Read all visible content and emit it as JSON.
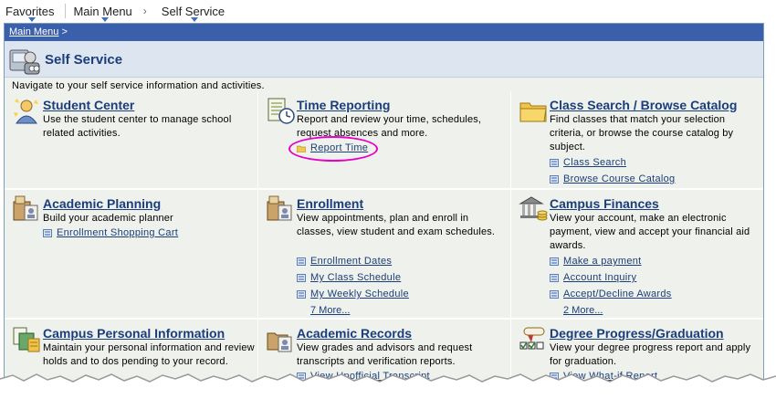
{
  "topnav": {
    "favorites": "Favorites",
    "main_menu": "Main Menu",
    "self_service": "Self Service"
  },
  "breadcrumb": {
    "main_menu": "Main Menu",
    "sep": " >"
  },
  "page": {
    "title": "Self Service",
    "nav_text": "Navigate to your self service information and activities."
  },
  "cells": {
    "student_center": {
      "title": "Student Center",
      "desc": "Use the student center to manage school related activities."
    },
    "time_reporting": {
      "title": "Time Reporting",
      "desc": "Report and review your time, schedules, request absences and more.",
      "links": [
        "Report Time"
      ]
    },
    "class_search": {
      "title": "Class Search / Browse Catalog",
      "desc": "Find classes that match your selection criteria, or browse the course catalog by subject.",
      "links": [
        "Class Search",
        "Browse Course Catalog"
      ]
    },
    "academic_planning": {
      "title": "Academic Planning",
      "desc": "Build your academic planner",
      "links": [
        "Enrollment Shopping Cart"
      ]
    },
    "enrollment": {
      "title": "Enrollment",
      "desc": "View appointments, plan and enroll in classes, view student and exam schedules.",
      "links": [
        "Enrollment Dates",
        "My Class Schedule",
        "My Weekly Schedule"
      ],
      "more": "7 More..."
    },
    "campus_finances": {
      "title": "Campus Finances",
      "desc": "View your account, make an electronic payment, view and accept your financial aid awards.",
      "links": [
        "Make a payment",
        "Account Inquiry",
        "Accept/Decline Awards"
      ],
      "more": "2 More..."
    },
    "campus_personal": {
      "title": "Campus Personal Information",
      "desc": "Maintain your personal information and review holds and to dos pending to your record."
    },
    "academic_records": {
      "title": "Academic Records",
      "desc": "View grades and advisors and request transcripts and verification reports.",
      "links": [
        "View Unofficial Transcript"
      ]
    },
    "degree_progress": {
      "title": "Degree Progress/Graduation",
      "desc": "View your degree progress report and apply for graduation.",
      "links": [
        "View What-if Report"
      ]
    }
  },
  "colors": {
    "link": "#1b3e7a",
    "crumbbar": "#3a5fab",
    "highlight": "#e600c8"
  }
}
